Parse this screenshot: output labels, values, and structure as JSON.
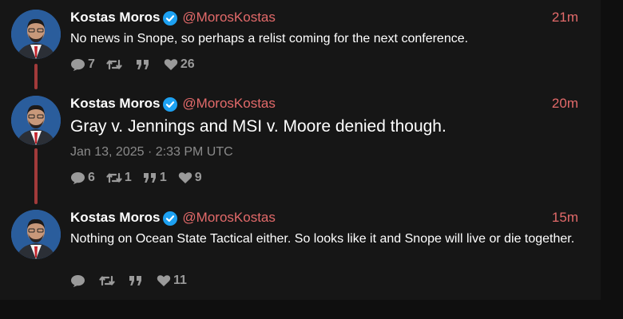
{
  "tweets": [
    {
      "author": "Kostas Moros",
      "handle": "@MorosKostas",
      "time": "21m",
      "text": "No news in Snope, so perhaps a relist coming for the next conference.",
      "replies": "7",
      "retweets": "",
      "quotes": "",
      "likes": "26"
    },
    {
      "author": "Kostas Moros",
      "handle": "@MorosKostas",
      "time": "20m",
      "text": "Gray v. Jennings and MSI v. Moore denied though.",
      "date": "Jan 13, 2025 · 2:33 PM UTC",
      "replies": "6",
      "retweets": "1",
      "quotes": "1",
      "likes": "9"
    },
    {
      "author": "Kostas Moros",
      "handle": "@MorosKostas",
      "time": "15m",
      "text": "Nothing on Ocean State Tactical either. So looks like it and Snope will live or die together.",
      "replies": "",
      "retweets": "",
      "quotes": "",
      "likes": "11"
    }
  ],
  "colors": {
    "accent": "#e36a6a",
    "thread_line": "#a13a3a",
    "verified": "#1da1f2",
    "background": "#161616",
    "muted": "#8a8a8a"
  },
  "icons": [
    "comment-icon",
    "retweet-icon",
    "quote-icon",
    "heart-icon",
    "verified-badge-icon"
  ]
}
